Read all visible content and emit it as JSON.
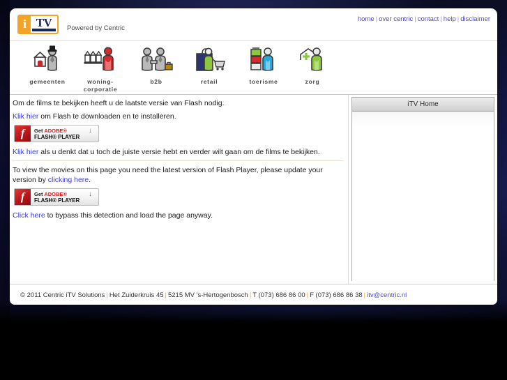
{
  "topnav": {
    "links": [
      {
        "label": "home"
      },
      {
        "label": "over centric"
      },
      {
        "label": "contact"
      },
      {
        "label": "help"
      },
      {
        "label": "disclaimer"
      }
    ],
    "separator": "|"
  },
  "brand": {
    "logo_i": "i",
    "logo_tv": "TV",
    "tagline": "Powered by Centric"
  },
  "iconnav": [
    {
      "label": "gemeenten",
      "icon": "gemeenten-icon"
    },
    {
      "label": "woning-\ncorporatie",
      "icon": "woningcorporatie-icon"
    },
    {
      "label": "b2b",
      "icon": "b2b-icon"
    },
    {
      "label": "retail",
      "icon": "retail-icon"
    },
    {
      "label": "toerisme",
      "icon": "toerisme-icon"
    },
    {
      "label": "zorg",
      "icon": "zorg-icon"
    }
  ],
  "content": {
    "nl_line1": "Om de films te bekijken heeft u de laatste versie van Flash nodig.",
    "nl_link1": "Klik hier",
    "nl_line2_rest": " om Flash te downloaden en te installeren.",
    "nl_link2": "Klik hier",
    "nl_line3_rest": " als u denkt dat u toch de juiste versie hebt en verder wilt gaan om de films te bekijken.",
    "en_line1_start": "To view the movies on this page you need the latest version of Flash Player, please update your version by ",
    "en_link1": "clicking here",
    "en_line1_end": ".",
    "en_link2": "Click here",
    "en_line2_rest": " to bypass this detection and load the page anyway."
  },
  "flash_badge": {
    "mark": "f",
    "get": "Get ",
    "adobe": "ADOBE®",
    "player": "FLASH® PLAYER",
    "download_arrow": "↓"
  },
  "sidebar": {
    "header": "iTV Home"
  },
  "footer": {
    "copyright": "© 2011 Centric iTV Solutions",
    "address": "Het Zuiderkruis 45",
    "city": "5215 MV  's-Hertogenbosch",
    "tel": "T (073) 686 86 00",
    "fax": "F (073) 686 86 38",
    "email": "itv@centric.nl",
    "separator": "|"
  },
  "colors": {
    "brand_orange": "#f3a326",
    "brand_navy": "#1b2361",
    "link_blue": "#3b3bd6",
    "desktop": "#121540"
  }
}
